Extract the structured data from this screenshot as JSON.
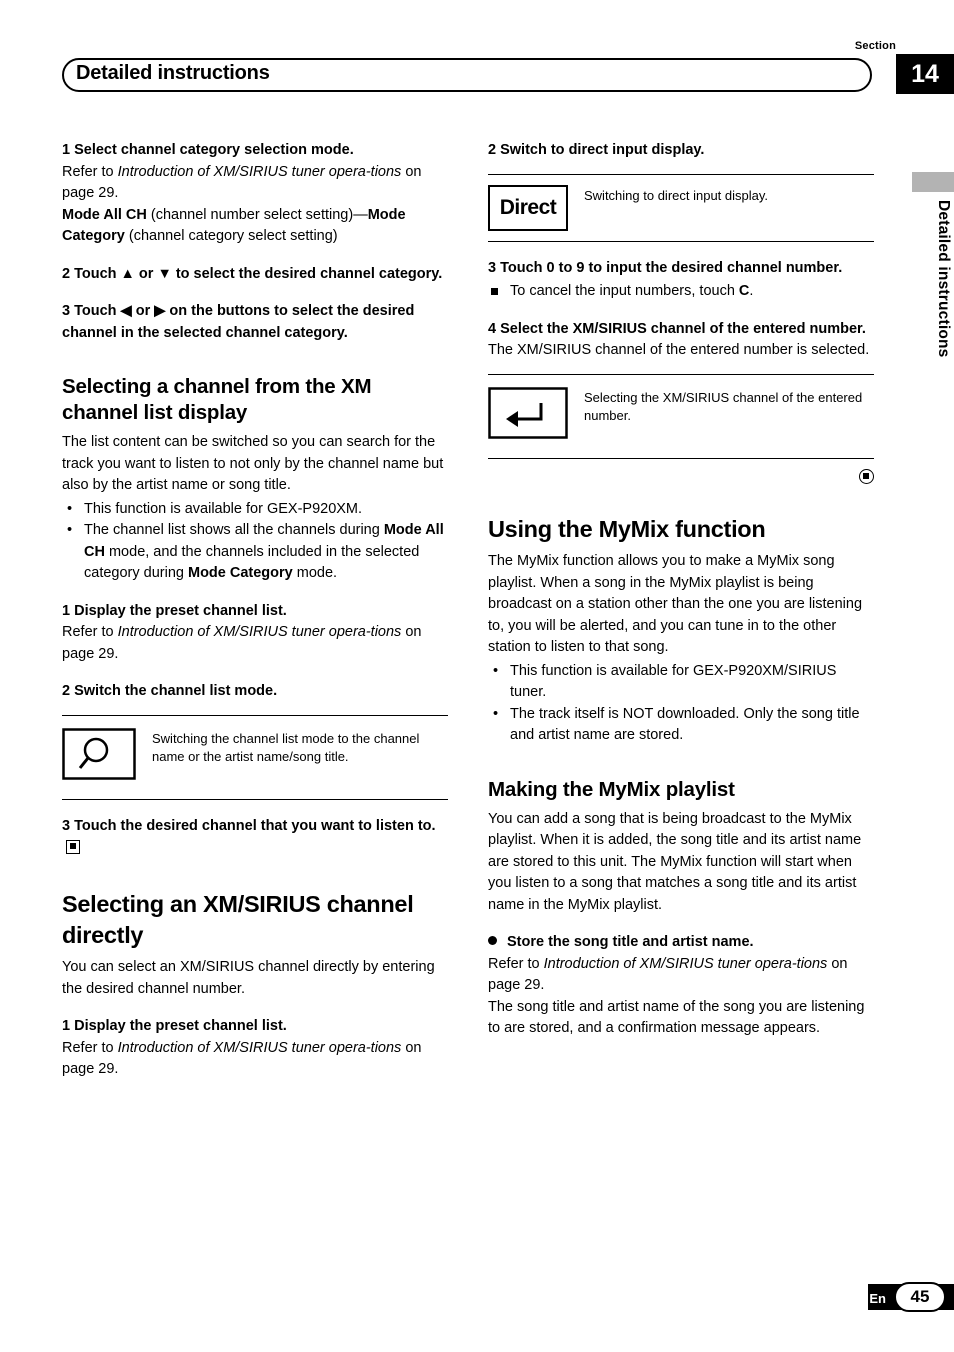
{
  "header": {
    "section_label": "Section",
    "section_number": "14",
    "title": "Detailed instructions",
    "side_tab": "Detailed instructions"
  },
  "footer": {
    "lang": "En",
    "page": "45"
  },
  "left": {
    "step1_head": "1    Select channel category selection mode.",
    "step1_body_1": "Refer to ",
    "step1_body_ital": "Introduction of XM/SIRIUS tuner opera-tions",
    "step1_body_2": " on page 29.",
    "step1_body_3a": "Mode All CH",
    "step1_body_3b": " (channel number select setting)",
    "step1_body_4a": "—",
    "step1_body_4b": "Mode Category",
    "step1_body_4c": " (channel category select setting)",
    "step2_head": "2    Touch ▲ or ▼ to select the desired channel category.",
    "step3_head": "3    Touch ◀ or ▶ on the buttons to select the desired channel in the selected channel category.",
    "h2_channel_list": "Selecting a channel from the XM channel list display",
    "intro": "The list content can be switched so you can search for the track you want to listen to not only by the channel name but also by the artist name or song title.",
    "bullet1": "This function is available for GEX-P920XM.",
    "bullet2_a": "The channel list shows all the channels during ",
    "bullet2_b": "Mode All CH",
    "bullet2_c": " mode, and the channels included in the selected category during ",
    "bullet2_d": "Mode Category",
    "bullet2_e": " mode.",
    "s1_head": "1    Display the preset channel list.",
    "s1_body_1": "Refer to ",
    "s1_body_ital": "Introduction of XM/SIRIUS tuner opera-tions",
    "s1_body_2": " on page 29.",
    "s2_head": "2    Switch the channel list mode.",
    "fig_search_caption": "Switching the channel list mode to the channel name or the artist name/song title.",
    "fig_search_icon": "magnifier-icon",
    "s3_head": "3    Touch the desired channel that you want to listen to.",
    "h1_direct": "Selecting an XM/SIRIUS channel directly",
    "direct_intro": "You can select an XM/SIRIUS channel directly by entering the desired channel number.",
    "d1_head": "1    Display the preset channel list.",
    "d1_body_1": "Refer to ",
    "d1_body_ital": "Introduction of XM/SIRIUS tuner opera-tions",
    "d1_body_2": " on page 29."
  },
  "right": {
    "d2_head": "2    Switch to direct input display.",
    "fig_direct_label": "Direct",
    "fig_direct_caption": "Switching to direct input display.",
    "d3_head": "3    Touch 0 to 9 to input the desired channel number.",
    "d3_note_a": "To cancel the input numbers, touch ",
    "d3_note_b": "C",
    "d3_note_c": ".",
    "d4_head": "4    Select the XM/SIRIUS channel of the entered number.",
    "d4_body": "The XM/SIRIUS channel of the entered number is selected.",
    "fig_enter_icon": "enter-arrow-icon",
    "fig_enter_caption": "Selecting the XM/SIRIUS channel of the entered number.",
    "h1_mymix": "Using the MyMix function",
    "mymix_intro": "The MyMix function allows you to make a MyMix song playlist. When a song in the MyMix playlist is being broadcast on a station other than the one you are listening to, you will be alerted, and you can tune in to the other station to listen to that song.",
    "mymix_bullet1": "This function is available for GEX-P920XM/SIRIUS tuner.",
    "mymix_bullet2": "The track itself is NOT downloaded. Only the song title and artist name are stored.",
    "h2_making": "Making the MyMix playlist",
    "making_body": "You can add a song that is being broadcast to the MyMix playlist. When it is added, the song title and its artist name are stored to this unit. The MyMix function will start when you listen to a song that matches a song title and its artist name in the MyMix playlist.",
    "store_head": "Store the song title and artist name.",
    "store_body_1": "Refer to ",
    "store_body_ital": "Introduction of XM/SIRIUS tuner opera-tions",
    "store_body_2": " on page 29.",
    "store_body_3": "The song title and artist name of the song you are listening to are stored, and a confirmation message appears."
  }
}
